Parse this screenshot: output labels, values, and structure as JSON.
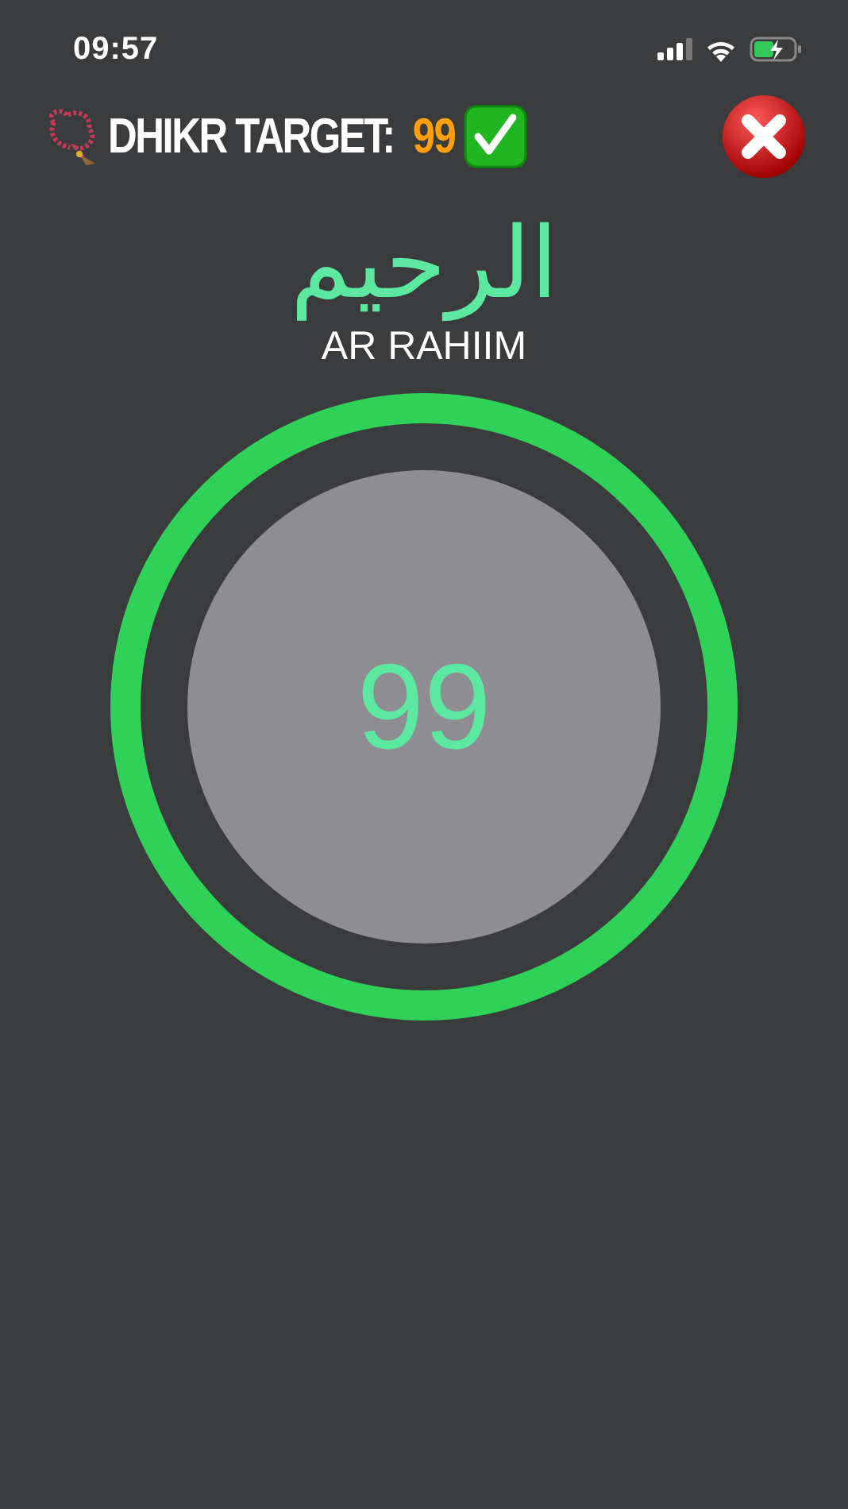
{
  "status_bar": {
    "time": "09:57"
  },
  "header": {
    "label": "DHIKR TARGET:",
    "target": "99",
    "completed": true
  },
  "name": {
    "arabic": "الرحيم",
    "transliteration": "AR RAHIIM"
  },
  "counter": {
    "count": "99",
    "level": 1
  }
}
